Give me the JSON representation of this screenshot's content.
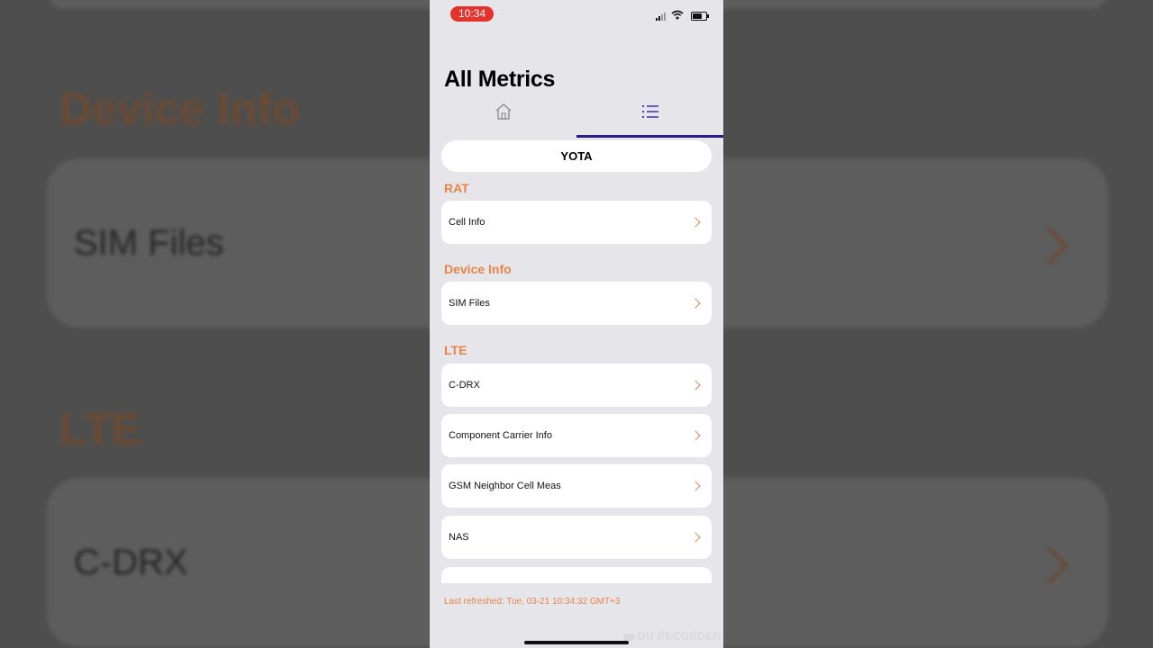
{
  "backdrop": {
    "heading_device_info": "Device Info",
    "label_sim_files": "SIM Files",
    "heading_lte": "LTE",
    "label_c_drx": "C-DRX"
  },
  "status_bar": {
    "time": "10:34",
    "time_badge_color": "#e5322d"
  },
  "header": {
    "title": "All Metrics",
    "tabs": [
      {
        "icon": "home-icon",
        "selected": false
      },
      {
        "icon": "list-icon",
        "selected": true
      }
    ],
    "indicator_color": "#2c1a8a"
  },
  "operator": "YOTA",
  "accent_color": "#e8844a",
  "sections": [
    {
      "title": "RAT",
      "items": [
        "Cell Info"
      ]
    },
    {
      "title": "Device Info",
      "items": [
        "SIM Files"
      ]
    },
    {
      "title": "LTE",
      "items": [
        "C-DRX",
        "Component Carrier Info",
        "GSM Neighbor Cell Meas",
        "NAS"
      ]
    }
  ],
  "footer": {
    "last_refreshed": "Last refreshed: Tue, 03-21 10:34:32 GMT+3"
  },
  "watermark": "DU RECORDER"
}
